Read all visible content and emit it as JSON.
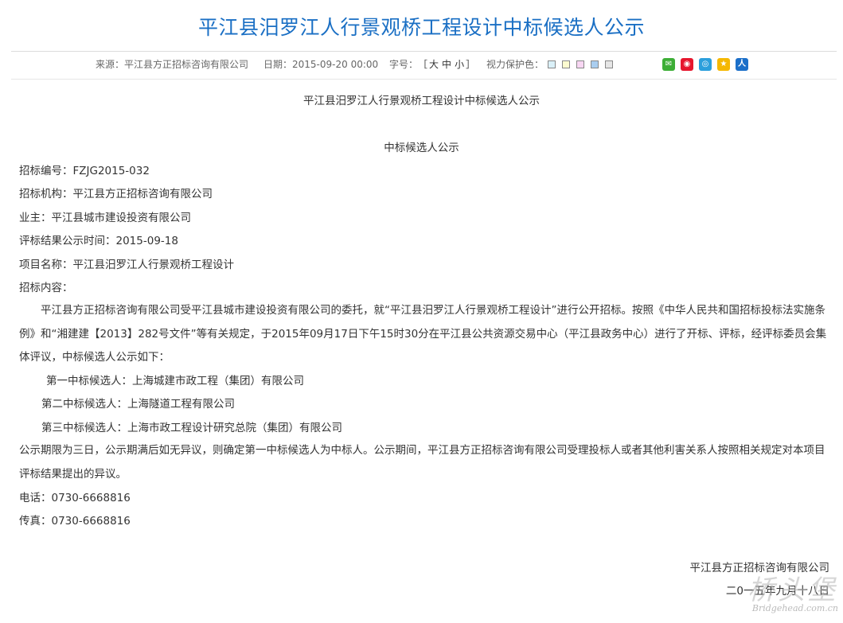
{
  "title": "平江县汨罗江人行景观桥工程设计中标候选人公示",
  "meta": {
    "source_label": "来源：",
    "source_value": "平江县方正招标咨询有限公司",
    "date_label": "日期：",
    "date_value": "2015-09-20 00:00",
    "fontsize_label": "字号：",
    "fontsize_open": "［",
    "fontsize_large": "大",
    "fontsize_medium": "中",
    "fontsize_small": "小",
    "fontsize_close": "］",
    "eye_label": "视力保护色：",
    "swatches": [
      "#daf0f8",
      "#fdfbd0",
      "#f8d6f3",
      "#a9cdef",
      "#e6e6e6"
    ],
    "share_icons": [
      {
        "name": "wechat-icon",
        "color": "#3dae36"
      },
      {
        "name": "weibo-icon",
        "color": "#e6162d"
      },
      {
        "name": "tencent-weibo-icon",
        "color": "#2b9fdc"
      },
      {
        "name": "qzone-icon",
        "color": "#f5b800"
      },
      {
        "name": "renren-icon",
        "color": "#1b6fc9"
      }
    ]
  },
  "content": {
    "subtitle": "平江县汨罗江人行景观桥工程设计中标候选人公示",
    "heading": "中标候选人公示",
    "bid_no": "招标编号：FZJG2015-032",
    "agency": "招标机构：平江县方正招标咨询有限公司",
    "owner": "业主：平江县城市建设投资有限公司",
    "result_time": "评标结果公示时间：2015-09-18",
    "project": "项目名称：平江县汨罗江人行景观桥工程设计",
    "content_label": "招标内容：",
    "body_paragraph": "　　平江县方正招标咨询有限公司受平江县城市建设投资有限公司的委托，就“平江县汨罗江人行景观桥工程设计”进行公开招标。按照《中华人民共和国招标投标法实施条例》和“湘建建【2013】282号文件”等有关规定，于2015年09月17日下午15时30分在平江县公共资源交易中心（平江县政务中心）进行了开标、评标，经评标委员会集体评议，中标候选人公示如下：",
    "candidate_1": "第一中标候选人：上海城建市政工程（集团）有限公司",
    "candidate_2": "第二中标候选人：上海隧道工程有限公司",
    "candidate_3": "第三中标候选人：上海市政工程设计研究总院（集团）有限公司",
    "notice_paragraph": " 公示期限为三日，公示期满后如无异议，则确定第一中标候选人为中标人。公示期间，平江县方正招标咨询有限公司受理投标人或者其他利害关系人按照相关规定对本项目评标结果提出的异议。",
    "phone": "电话：0730-6668816",
    "fax": "传真：0730-6668816",
    "signature_org": "平江县方正招标咨询有限公司",
    "signature_date": "二0一五年九月十八日"
  },
  "watermark": {
    "cn": "桥头堡",
    "en": "Bridgehead.com.cn"
  }
}
